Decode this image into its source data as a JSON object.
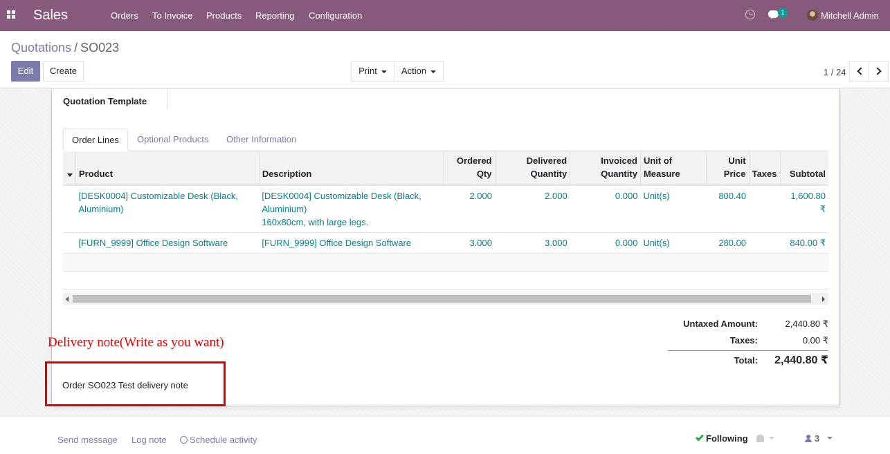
{
  "navbar": {
    "brand": "Sales",
    "menu": [
      "Orders",
      "To Invoice",
      "Products",
      "Reporting",
      "Configuration"
    ],
    "chat_count": "1",
    "user_name": "Mitchell Admin",
    "bg_color": "#875a7b"
  },
  "breadcrumb": {
    "parent": "Quotations",
    "separator": "/",
    "current": "SO023"
  },
  "buttons": {
    "edit": "Edit",
    "create": "Create",
    "print": "Print",
    "action": "Action"
  },
  "pager": {
    "value": "1 / 24"
  },
  "form": {
    "quotation_template_label": "Quotation Template"
  },
  "tabs": [
    "Order Lines",
    "Optional Products",
    "Other Information"
  ],
  "table": {
    "headers": {
      "product": "Product",
      "description": "Description",
      "ordered_1": "Ordered",
      "ordered_2": "Qty",
      "delivered_1": "Delivered",
      "delivered_2": "Quantity",
      "invoiced_1": "Invoiced",
      "invoiced_2": "Quantity",
      "uom_1": "Unit of",
      "uom_2": "Measure",
      "unit_price_1": "Unit",
      "unit_price_2": "Price",
      "taxes": "Taxes",
      "subtotal": "Subtotal"
    },
    "rows": [
      {
        "product_1": "[DESK0004] Customizable Desk (Black,",
        "product_2": "Aluminium)",
        "desc_1": "[DESK0004] Customizable Desk (Black,",
        "desc_2": "Aluminium)",
        "desc_3": "160x80cm, with large legs.",
        "ordered": "2.000",
        "delivered": "2.000",
        "invoiced": "0.000",
        "uom": "Unit(s)",
        "price": "800.40",
        "taxes": "",
        "subtotal": "1,600.80 ₹"
      },
      {
        "product_1": "[FURN_9999] Office Design Software",
        "desc_1": "[FURN_9999] Office Design Software",
        "ordered": "3.000",
        "delivered": "3.000",
        "invoiced": "0.000",
        "uom": "Unit(s)",
        "price": "280.00",
        "taxes": "",
        "subtotal": "840.00 ₹"
      }
    ]
  },
  "totals": {
    "untaxed_label": "Untaxed Amount:",
    "untaxed_value": "2,440.80 ₹",
    "taxes_label": "Taxes:",
    "taxes_value": "0.00 ₹",
    "total_label": "Total:",
    "total_value": "2,440.80 ₹"
  },
  "annotation": {
    "text": "Delivery note(Write as you want)",
    "color": "#e00000"
  },
  "note": {
    "text": "Order SO023 Test delivery note"
  },
  "chatter": {
    "send_message": "Send message",
    "log_note": "Log note",
    "schedule_activity": "Schedule activity",
    "following": "Following",
    "followers_count": "3"
  }
}
